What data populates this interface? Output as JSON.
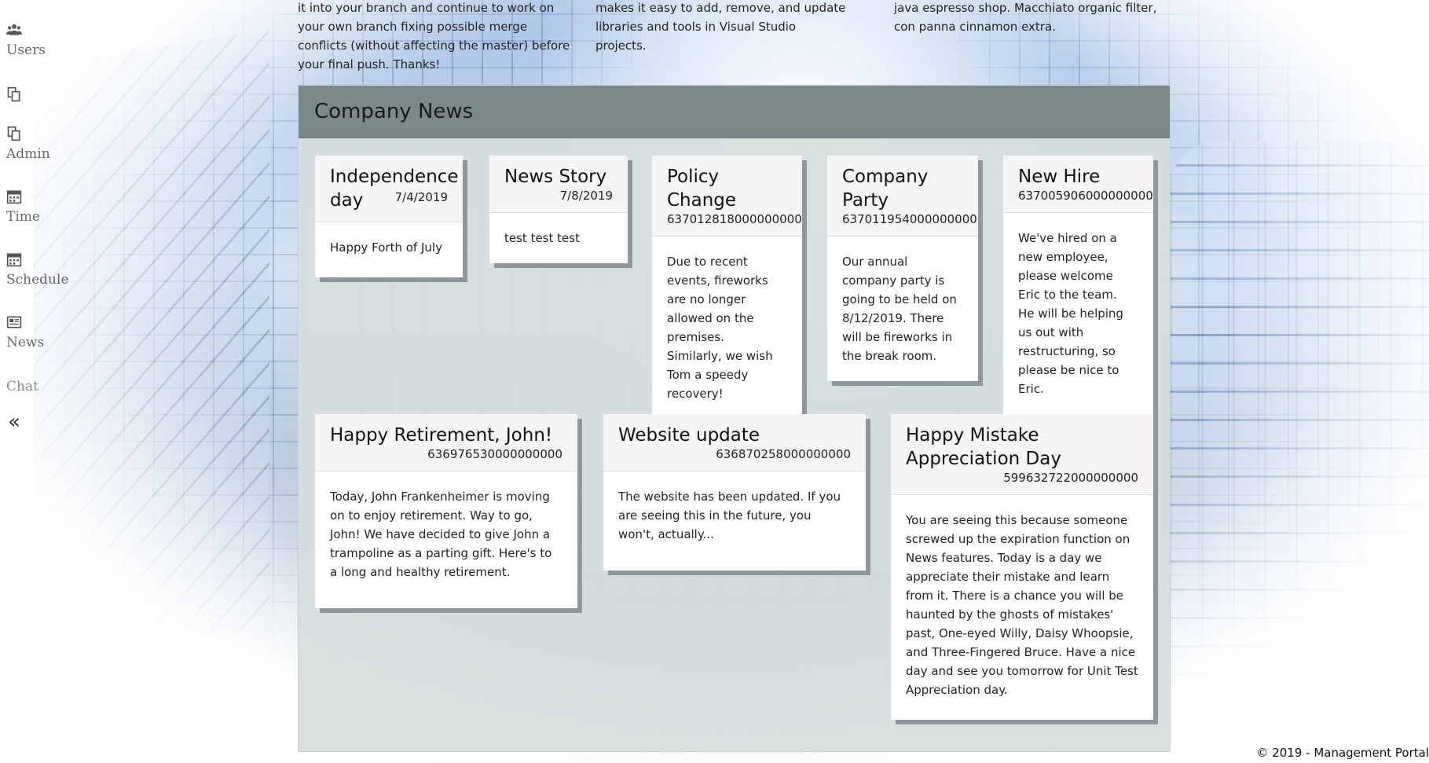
{
  "sidebar": {
    "items": [
      {
        "icon": "users-icon",
        "label": "Users"
      },
      {
        "icon": "copy-icon",
        "label": ""
      },
      {
        "icon": "copy-icon",
        "label": "Admin"
      },
      {
        "icon": "calendar-icon",
        "label": "Time"
      },
      {
        "icon": "calendar-icon",
        "label": "Schedule"
      },
      {
        "icon": "newspaper-icon",
        "label": "News"
      },
      {
        "icon": "",
        "label": "Chat"
      }
    ],
    "collapse_glyph": "«"
  },
  "top_columns": [
    {
      "text": "it into your branch and continue to work on your own branch fixing possible merge conflicts (without affecting the master) before your final push. Thanks!"
    },
    {
      "text": "makes it easy to add, remove, and update libraries and tools in Visual Studio projects."
    },
    {
      "text": "java espresso shop. Macchiato organic filter, con panna cinnamon extra."
    }
  ],
  "news": {
    "title": "Company News",
    "cards": [
      {
        "title": "Independence day",
        "date": "7/4/2019",
        "body": "Happy Forth of July"
      },
      {
        "title": "News Story",
        "date": "7/8/2019",
        "body": "test test test"
      },
      {
        "title": "Policy Change",
        "date": "637012818000000000",
        "body": "Due to recent events, fireworks are no longer allowed on the premises. Similarly, we wish Tom a speedy recovery!"
      },
      {
        "title": "Company Party",
        "date": "637011954000000000",
        "body": "Our annual company party is going to be held on 8/12/2019. There will be fireworks in the break room."
      },
      {
        "title": "New Hire",
        "date": "637005906000000000",
        "body": "We've hired on a new employee, please welcome Eric to the team. He will be helping us out with restructuring, so please be nice to Eric."
      },
      {
        "title": "Happy Retirement, John!",
        "date": "636976530000000000",
        "body": "Today, John Frankenheimer is moving on to enjoy retirement. Way to go, John! We have decided to give John a trampoline as a parting gift. Here's to a long and healthy retirement."
      },
      {
        "title": "Website update",
        "date": "636870258000000000",
        "body": "The website has been updated. If you are seeing this in the future, you won't, actually..."
      },
      {
        "title": "Happy Mistake Appreciation Day",
        "date": "599632722000000000",
        "body": "You are seeing this because someone screwed up the expiration function on News features. Today is a day we appreciate their mistake and learn from it. There is a chance you will be haunted by the ghosts of mistakes' past, One-eyed Willy, Daisy Whoopsie, and Three-Fingered Bruce. Have a nice day and see you tomorrow for Unit Test Appreciation day."
      }
    ]
  },
  "footer": {
    "text": "© 2019 - Management Portal"
  }
}
